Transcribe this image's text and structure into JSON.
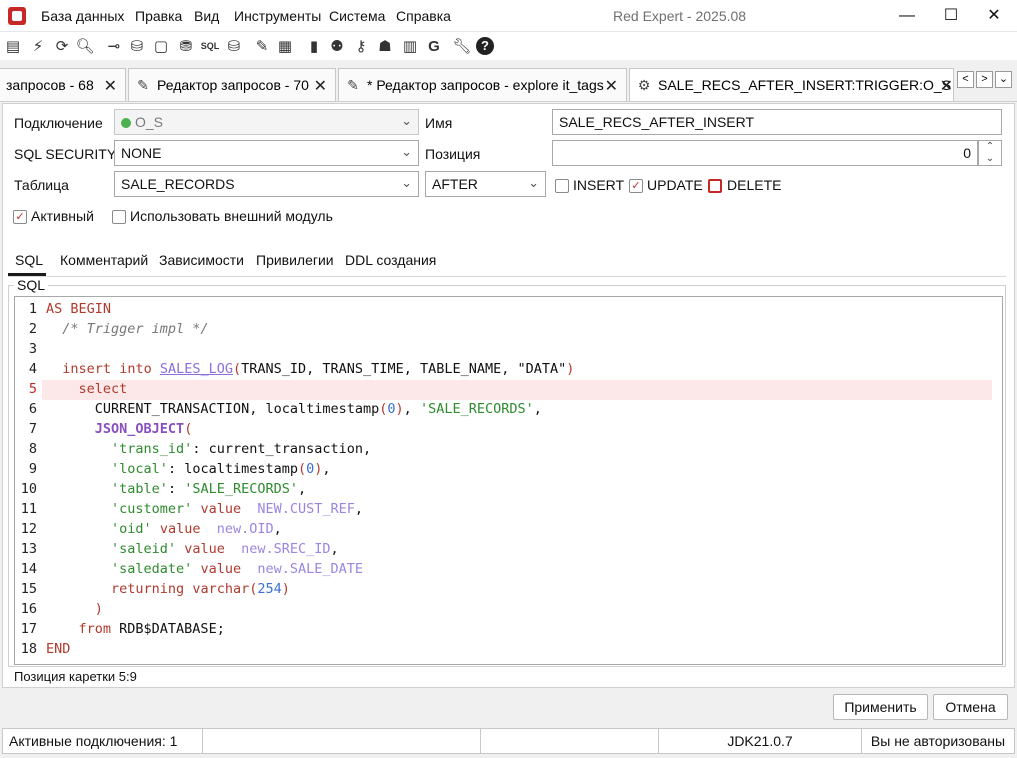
{
  "window": {
    "title": "Red Expert - 2025.08",
    "menu": [
      "База данных",
      "Правка",
      "Вид",
      "Инструменты",
      "Система",
      "Справка"
    ],
    "controls": {
      "minimize": "—",
      "maximize": "☐",
      "close": "✕"
    }
  },
  "toolbar": {
    "icons": [
      "tree-icon",
      "disconnect-icon",
      "refresh-icon",
      "search-icon",
      "connect-icon",
      "database-add-icon",
      "editor-icon",
      "database-stack-icon",
      "sql-icon",
      "database-check-icon",
      "pen-icon",
      "table-icon",
      "chart-icon",
      "users-icon",
      "key-icon",
      "grant-icon",
      "export-icon",
      "generator-icon",
      "tools-icon",
      "help-icon"
    ],
    "sql_label": "SQL",
    "g_label": "G"
  },
  "tabs": [
    {
      "label": "запросов - 68",
      "active": false
    },
    {
      "label": "Редактор запросов - 70",
      "active": false
    },
    {
      "label": "* Редактор запросов - explore it_tags",
      "active": false
    },
    {
      "label": "SALE_RECS_AFTER_INSERT:TRIGGER:O_S",
      "active": true
    }
  ],
  "form": {
    "connection_label": "Подключение",
    "connection_value": "O_S",
    "name_label": "Имя",
    "name_value": "SALE_RECS_AFTER_INSERT",
    "sql_security_label": "SQL SECURITY",
    "sql_security_value": "NONE",
    "position_label": "Позиция",
    "position_value": "0",
    "table_label": "Таблица",
    "table_value": "SALE_RECORDS",
    "timing_value": "AFTER",
    "insert_label": "INSERT",
    "insert_checked": false,
    "update_label": "UPDATE",
    "update_checked": true,
    "delete_label": "DELETE",
    "delete_checked": false,
    "active_label": "Активный",
    "active_checked": true,
    "external_label": "Использовать внешний модуль",
    "external_checked": false
  },
  "subtabs": [
    "SQL",
    "Комментарий",
    "Зависимости",
    "Привилегии",
    "DDL создания"
  ],
  "sql_group_title": "SQL",
  "editor": {
    "line_numbers": [
      "1",
      "2",
      "3",
      "4",
      "5",
      "6",
      "7",
      "8",
      "9",
      "10",
      "11",
      "12",
      "13",
      "14",
      "15",
      "16",
      "17",
      "18"
    ],
    "lines": [
      "AS BEGIN",
      "  /* Trigger impl */",
      "",
      "  insert into SALES_LOG(TRANS_ID, TRANS_TIME, TABLE_NAME, \"DATA\")",
      "    select",
      "      CURRENT_TRANSACTION, localtimestamp(0), 'SALE_RECORDS',",
      "      JSON_OBJECT(",
      "        'trans_id': current_transaction,",
      "        'local': localtimestamp(0),",
      "        'table': 'SALE_RECORDS',",
      "        'customer' value  NEW.CUST_REF,",
      "        'oid' value  new.OID,",
      "        'saleid' value  new.SREC_ID,",
      "        'saledate' value  new.SALE_DATE",
      "        returning varchar(254)",
      "      )",
      "    from RDB$DATABASE;",
      "END"
    ],
    "highlighted_line": 5
  },
  "caret_status": "Позиция каретки 5:9",
  "buttons": {
    "apply": "Применить",
    "cancel": "Отмена"
  },
  "statusbar": {
    "connections": "Активные подключения: 1",
    "jdk": "JDK21.0.7",
    "auth": "Вы не авторизованы"
  },
  "colors": {
    "accent_red": "#c62828",
    "keyword": "#b03a2e",
    "string": "#2e8b2e",
    "number": "#3b6ed8",
    "highlight": "#fce8e8"
  }
}
